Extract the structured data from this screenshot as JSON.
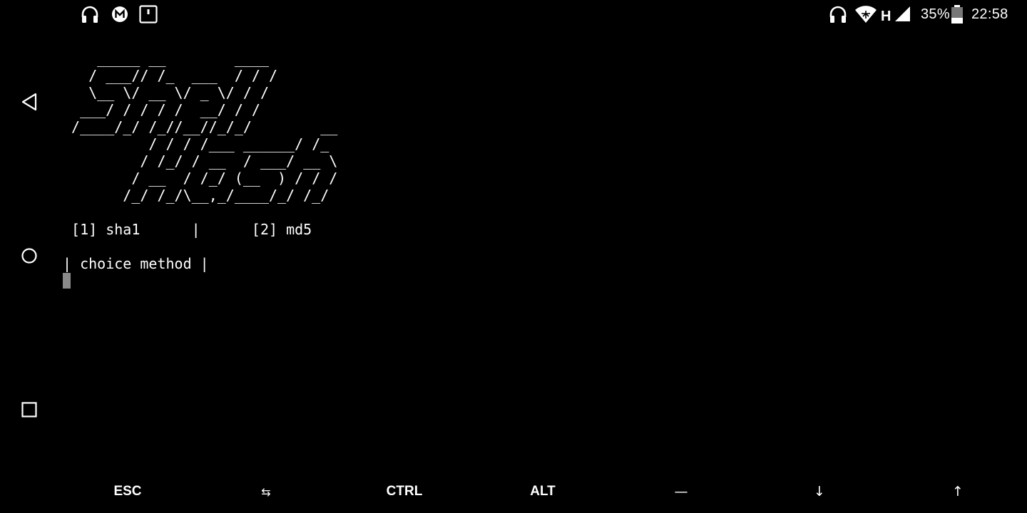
{
  "status_bar": {
    "left_icons": [
      "headphones-icon",
      "mega-icon",
      "notification-square-icon"
    ],
    "right_icons": [
      "headphones-icon",
      "wifi-icon",
      "signal-icon",
      "battery-icon"
    ],
    "network_type": "H",
    "battery_percent": "35%",
    "battery_level": 0.35,
    "time": "22:58"
  },
  "nav_bar": {
    "buttons": [
      "back-icon",
      "home-icon",
      "recents-icon"
    ]
  },
  "terminal": {
    "lines": [
      "    _____ __        ____",
      "   / ___// /_  ___  / / /",
      "   \\__ \\/ __ \\/ _ \\/ / /",
      "  ___/ / / / /  __/ / /",
      " /____/_/ /_//__//_/_/        __",
      "          / / / /___ ______/ /_",
      "         / /_/ / __  / ___/ __ \\",
      "        / __  / /_/ (__  ) / / /",
      "       /_/ /_/\\__,_/____/_/ /_/",
      "",
      " [1] sha1      |      [2] md5",
      "",
      "| choice method |"
    ]
  },
  "extra_keys": [
    "ESC",
    "⇆",
    "CTRL",
    "ALT",
    "—",
    "↓",
    "↑"
  ],
  "colors": {
    "background": "#000000",
    "foreground": "#ffffff",
    "cursor": "#8a8a8a"
  }
}
